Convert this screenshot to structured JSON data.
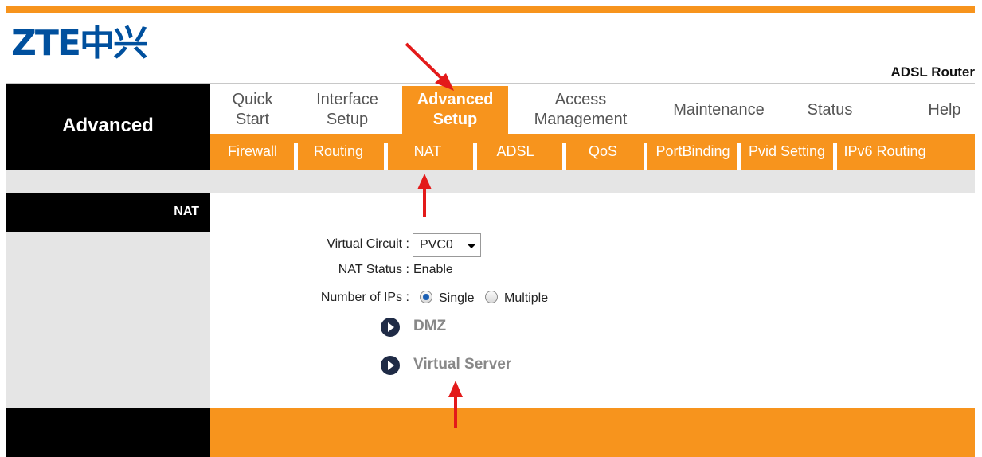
{
  "brand": {
    "logo": "ZTE中兴",
    "product": "ADSL Router"
  },
  "section": "Advanced",
  "nav": {
    "tabs": [
      {
        "label": "Quick\nStart",
        "active": false
      },
      {
        "label": "Interface\nSetup",
        "active": false
      },
      {
        "label": "Advanced\nSetup",
        "active": true
      },
      {
        "label": "Access\nManagement",
        "active": false
      },
      {
        "label": "Maintenance",
        "active": false
      },
      {
        "label": "Status",
        "active": false
      },
      {
        "label": "Help",
        "active": false
      }
    ],
    "subtabs": [
      "Firewall",
      "Routing",
      "NAT",
      "ADSL",
      "QoS",
      "PortBinding",
      "Pvid Setting",
      "IPv6 Routing"
    ]
  },
  "page_title": "NAT",
  "form": {
    "virtual_circuit_label": "Virtual Circuit :",
    "virtual_circuit_value": "PVC0",
    "nat_status_label": "NAT Status :",
    "nat_status_value": "Enable",
    "num_ips_label": "Number of IPs :",
    "option_single": "Single",
    "option_multiple": "Multiple",
    "selected_option": "Single"
  },
  "links": {
    "dmz": "DMZ",
    "virtual_server": "Virtual Server"
  },
  "colors": {
    "accent": "#f7941d",
    "annotation": "#e31a1a",
    "brand": "#00509e"
  }
}
